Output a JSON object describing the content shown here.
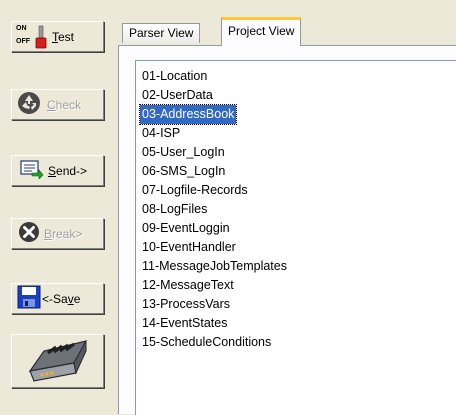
{
  "toolbar": {
    "test": {
      "on": "ON",
      "off": "OFF",
      "accel": "T",
      "rest": "est"
    },
    "check": {
      "accel": "C",
      "rest": "heck"
    },
    "send": {
      "accel": "S",
      "rest": "end->"
    },
    "break": {
      "accel": "B",
      "rest": "reak>"
    },
    "save": {
      "pre": "<-Sa",
      "accel": "v",
      "rest": "e"
    }
  },
  "tabs": [
    {
      "label": "Parser View",
      "active": false
    },
    {
      "label": "Project View",
      "active": true
    }
  ],
  "project_list": {
    "items": [
      "01-Location",
      "02-UserData",
      "03-AddressBook",
      "04-ISP",
      "05-User_LogIn",
      "06-SMS_LogIn",
      "07-Logfile-Records",
      "08-LogFiles",
      "09-EventLoggin",
      "10-EventHandler",
      "11-MessageJobTemplates",
      "12-MessageText",
      "13-ProcessVars",
      "14-EventStates",
      "15-ScheduleConditions"
    ],
    "selected": "03-AddressBook"
  },
  "colors": {
    "selection": "#316ac5",
    "tab_highlight": "#ffc83c",
    "background": "#ece9d8"
  }
}
